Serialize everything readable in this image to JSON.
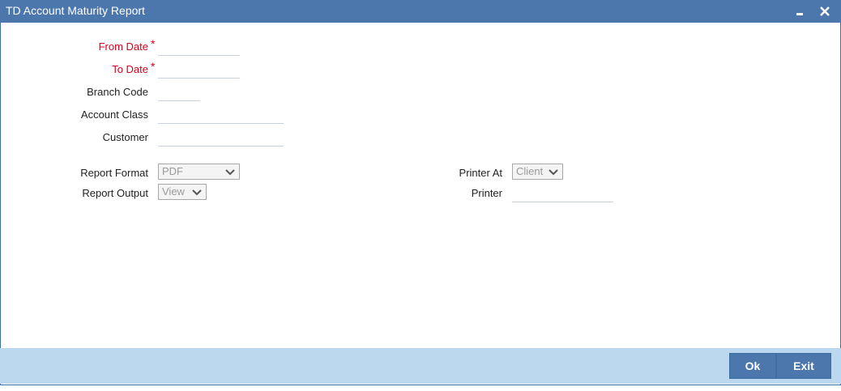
{
  "window": {
    "title": "TD Account Maturity Report"
  },
  "form": {
    "from_date": {
      "label": "From Date",
      "required_mark": "*",
      "value": ""
    },
    "to_date": {
      "label": "To Date",
      "required_mark": "*",
      "value": ""
    },
    "branch_code": {
      "label": "Branch Code",
      "value": ""
    },
    "account_class": {
      "label": "Account Class",
      "value": ""
    },
    "customer": {
      "label": "Customer",
      "value": ""
    }
  },
  "report": {
    "format_label": "Report Format",
    "format_value": "PDF",
    "output_label": "Report Output",
    "output_value": "View",
    "printer_at_label": "Printer At",
    "printer_at_value": "Client",
    "printer_label": "Printer",
    "printer_value": ""
  },
  "footer": {
    "ok_label": "Ok",
    "exit_label": "Exit"
  },
  "colors": {
    "titlebar": "#4b77ad",
    "footer": "#bcd8ee",
    "required": "#d0021b"
  }
}
